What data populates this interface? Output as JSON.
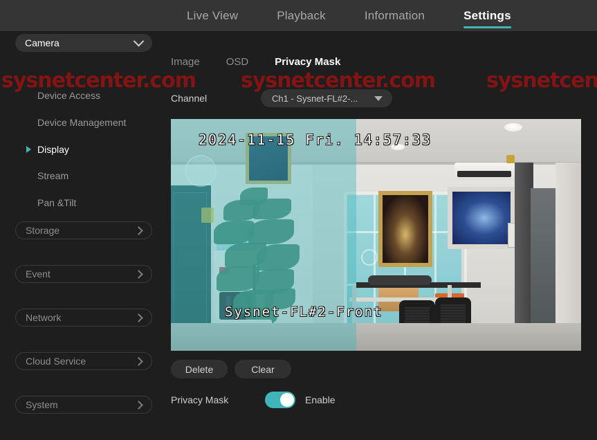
{
  "topnav": {
    "items": [
      {
        "label": "Live View",
        "active": false
      },
      {
        "label": "Playback",
        "active": false
      },
      {
        "label": "Information",
        "active": false
      },
      {
        "label": "Settings",
        "active": true
      }
    ]
  },
  "sidebar": {
    "camera_group": {
      "label": "Camera",
      "icon": "chevron-down-icon",
      "expanded": true
    },
    "camera_items": [
      {
        "label": "Device Access",
        "active": false
      },
      {
        "label": "Device Management",
        "active": false
      },
      {
        "label": "Display",
        "active": true
      },
      {
        "label": "Stream",
        "active": false
      },
      {
        "label": "Pan &Tilt",
        "active": false
      }
    ],
    "groups": [
      {
        "label": "Storage",
        "icon": "chevron-right-icon"
      },
      {
        "label": "Event",
        "icon": "chevron-right-icon"
      },
      {
        "label": "Network",
        "icon": "chevron-right-icon"
      },
      {
        "label": "Cloud Service",
        "icon": "chevron-right-icon"
      },
      {
        "label": "System",
        "icon": "chevron-right-icon"
      }
    ]
  },
  "content": {
    "tabs": [
      {
        "label": "Image",
        "active": false
      },
      {
        "label": "OSD",
        "active": false
      },
      {
        "label": "Privacy Mask",
        "active": true
      }
    ],
    "channel": {
      "label": "Channel",
      "value": "Ch1 - Sysnet-FL#2-...",
      "icon": "caret-down-icon"
    },
    "video": {
      "osd_timestamp": "2024-11-15 Fri. 14:57:33",
      "osd_camera_name": "Sysnet-FL#2-Front"
    },
    "buttons": [
      {
        "label": "Delete"
      },
      {
        "label": "Clear"
      }
    ],
    "privacy_mask": {
      "label": "Privacy Mask",
      "toggle_state": "on",
      "toggle_text": "Enable"
    }
  },
  "watermarks": [
    {
      "text": "sysnetcenter.com"
    },
    {
      "text": "sysnetcenter.com"
    },
    {
      "text": "sysnetcent"
    }
  ],
  "colors": {
    "accent": "#3fb5ba",
    "header_bg": "#353535",
    "body_bg": "#1e1e1e",
    "watermark": "#8d1414"
  }
}
